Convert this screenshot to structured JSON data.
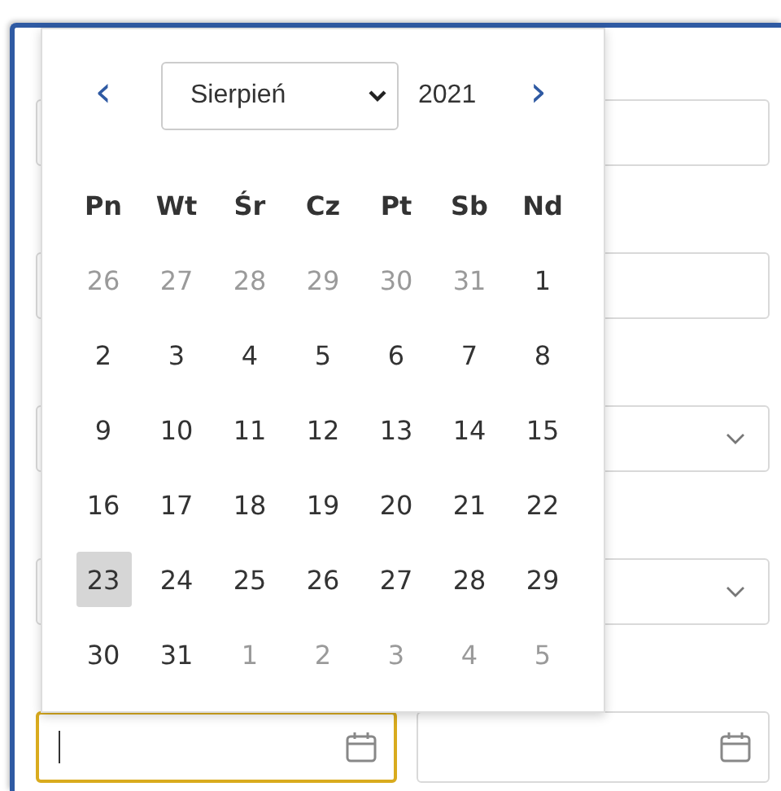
{
  "fields": [
    {
      "kind": "text",
      "focused": false
    },
    {
      "kind": "text",
      "focused": false
    },
    {
      "kind": "select",
      "focused": false
    },
    {
      "kind": "select",
      "focused": false
    }
  ],
  "date_fields": [
    {
      "focused": true
    },
    {
      "focused": false
    }
  ],
  "calendar": {
    "prev": "‹",
    "next": "›",
    "month": "Sierpień",
    "year": "2021",
    "weekdays": [
      "Pn",
      "Wt",
      "Śr",
      "Cz",
      "Pt",
      "Sb",
      "Nd"
    ],
    "weeks": [
      [
        {
          "day": "26",
          "outside": true,
          "selected": false
        },
        {
          "day": "27",
          "outside": true,
          "selected": false
        },
        {
          "day": "28",
          "outside": true,
          "selected": false
        },
        {
          "day": "29",
          "outside": true,
          "selected": false
        },
        {
          "day": "30",
          "outside": true,
          "selected": false
        },
        {
          "day": "31",
          "outside": true,
          "selected": false
        },
        {
          "day": "1",
          "outside": false,
          "selected": false
        }
      ],
      [
        {
          "day": "2",
          "outside": false,
          "selected": false
        },
        {
          "day": "3",
          "outside": false,
          "selected": false
        },
        {
          "day": "4",
          "outside": false,
          "selected": false
        },
        {
          "day": "5",
          "outside": false,
          "selected": false
        },
        {
          "day": "6",
          "outside": false,
          "selected": false
        },
        {
          "day": "7",
          "outside": false,
          "selected": false
        },
        {
          "day": "8",
          "outside": false,
          "selected": false
        }
      ],
      [
        {
          "day": "9",
          "outside": false,
          "selected": false
        },
        {
          "day": "10",
          "outside": false,
          "selected": false
        },
        {
          "day": "11",
          "outside": false,
          "selected": false
        },
        {
          "day": "12",
          "outside": false,
          "selected": false
        },
        {
          "day": "13",
          "outside": false,
          "selected": false
        },
        {
          "day": "14",
          "outside": false,
          "selected": false
        },
        {
          "day": "15",
          "outside": false,
          "selected": false
        }
      ],
      [
        {
          "day": "16",
          "outside": false,
          "selected": false
        },
        {
          "day": "17",
          "outside": false,
          "selected": false
        },
        {
          "day": "18",
          "outside": false,
          "selected": false
        },
        {
          "day": "19",
          "outside": false,
          "selected": false
        },
        {
          "day": "20",
          "outside": false,
          "selected": false
        },
        {
          "day": "21",
          "outside": false,
          "selected": false
        },
        {
          "day": "22",
          "outside": false,
          "selected": false
        }
      ],
      [
        {
          "day": "23",
          "outside": false,
          "selected": true
        },
        {
          "day": "24",
          "outside": false,
          "selected": false
        },
        {
          "day": "25",
          "outside": false,
          "selected": false
        },
        {
          "day": "26",
          "outside": false,
          "selected": false
        },
        {
          "day": "27",
          "outside": false,
          "selected": false
        },
        {
          "day": "28",
          "outside": false,
          "selected": false
        },
        {
          "day": "29",
          "outside": false,
          "selected": false
        }
      ],
      [
        {
          "day": "30",
          "outside": false,
          "selected": false
        },
        {
          "day": "31",
          "outside": false,
          "selected": false
        },
        {
          "day": "1",
          "outside": true,
          "selected": false
        },
        {
          "day": "2",
          "outside": true,
          "selected": false
        },
        {
          "day": "3",
          "outside": true,
          "selected": false
        },
        {
          "day": "4",
          "outside": true,
          "selected": false
        },
        {
          "day": "5",
          "outside": true,
          "selected": false
        }
      ]
    ]
  }
}
